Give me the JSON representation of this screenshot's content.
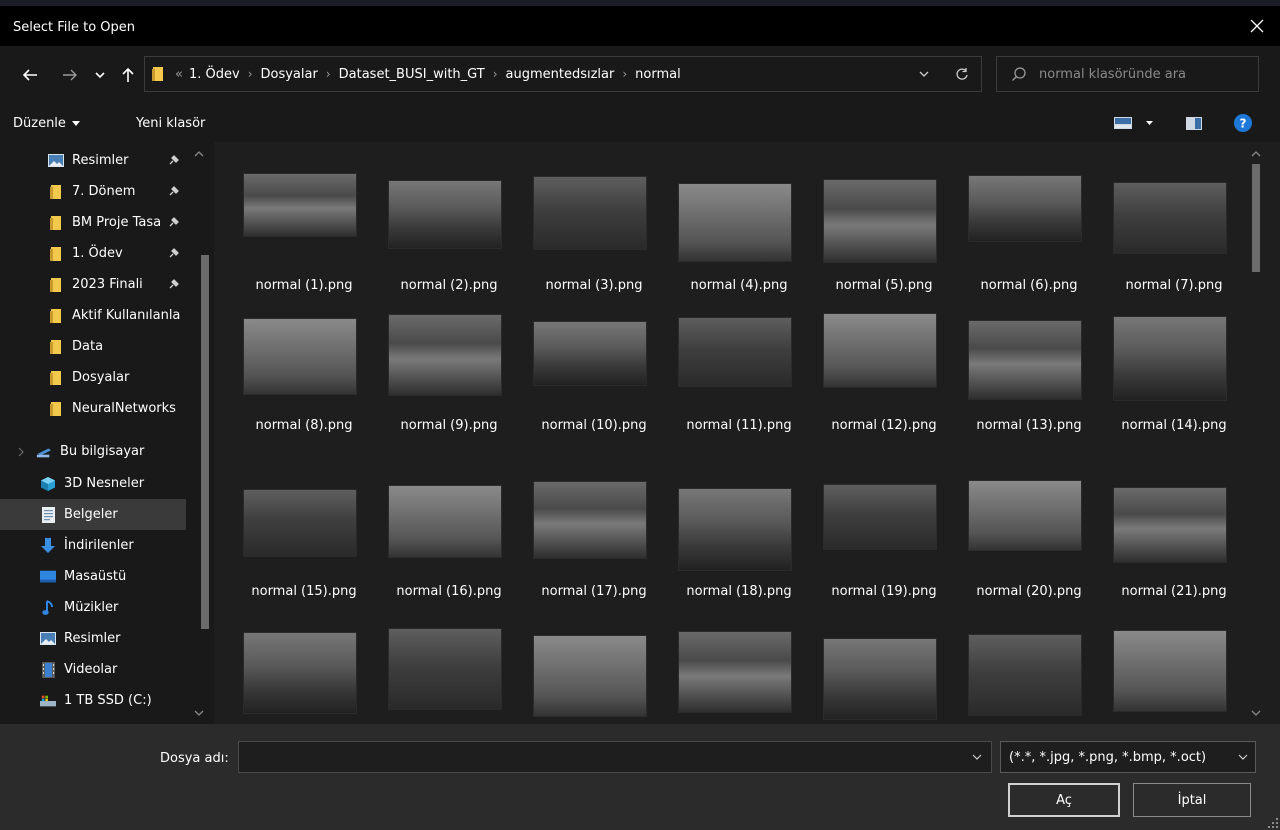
{
  "window": {
    "title": "Select File to Open"
  },
  "nav": {
    "breadcrumb_prefix": "«",
    "crumbs": [
      "1. Ödev",
      "Dosyalar",
      "Dataset_BUSI_with_GT",
      "augmentedsızlar",
      "normal"
    ],
    "search_placeholder": "normal klasöründe ara"
  },
  "toolbar": {
    "organize_label": "Düzenle",
    "new_folder_label": "Yeni klasör"
  },
  "sidebar": {
    "quick_access": [
      {
        "label": "Resimler",
        "icon": "pictures-icon",
        "pinned": true
      },
      {
        "label": "7. Dönem",
        "icon": "folder-icon",
        "pinned": true
      },
      {
        "label": "BM Proje Tasa",
        "icon": "folder-icon",
        "pinned": true
      },
      {
        "label": "1. Ödev",
        "icon": "folder-icon",
        "pinned": true
      },
      {
        "label": "2023 Finali",
        "icon": "folder-icon",
        "pinned": true
      },
      {
        "label": "Aktif Kullanılanla",
        "icon": "folder-icon",
        "pinned": false
      },
      {
        "label": "Data",
        "icon": "folder-icon",
        "pinned": false
      },
      {
        "label": "Dosyalar",
        "icon": "folder-icon",
        "pinned": false
      },
      {
        "label": "NeuralNetworks",
        "icon": "folder-icon",
        "pinned": false
      }
    ],
    "this_pc": {
      "label": "Bu bilgisayar"
    },
    "pc_items": [
      {
        "label": "3D Nesneler",
        "icon": "3d-objects-icon"
      },
      {
        "label": "Belgeler",
        "icon": "documents-icon",
        "selected": true
      },
      {
        "label": "İndirilenler",
        "icon": "downloads-icon"
      },
      {
        "label": "Masaüstü",
        "icon": "desktop-icon"
      },
      {
        "label": "Müzikler",
        "icon": "music-icon"
      },
      {
        "label": "Resimler",
        "icon": "pictures-icon"
      },
      {
        "label": "Videolar",
        "icon": "videos-icon"
      },
      {
        "label": "1 TB SSD (C:)",
        "icon": "drive-icon"
      }
    ]
  },
  "files": [
    "normal (1).png",
    "normal (2).png",
    "normal (3).png",
    "normal (4).png",
    "normal (5).png",
    "normal (6).png",
    "normal (7).png",
    "normal (8).png",
    "normal (9).png",
    "normal (10).png",
    "normal (11).png",
    "normal (12).png",
    "normal (13).png",
    "normal (14).png",
    "normal (15).png",
    "normal (16).png",
    "normal (17).png",
    "normal (18).png",
    "normal (19).png",
    "normal (20).png",
    "normal (21).png",
    "",
    "",
    "",
    "",
    "",
    "",
    ""
  ],
  "bottom": {
    "filename_label": "Dosya adı:",
    "filename_value": "",
    "filetype_value": "(*.*, *.jpg, *.png, *.bmp, *.oct)",
    "open_label": "Aç",
    "cancel_label": "İptal"
  },
  "colors": {
    "help_blue": "#1e78d7",
    "folder_yellow": "#f2c94c"
  }
}
